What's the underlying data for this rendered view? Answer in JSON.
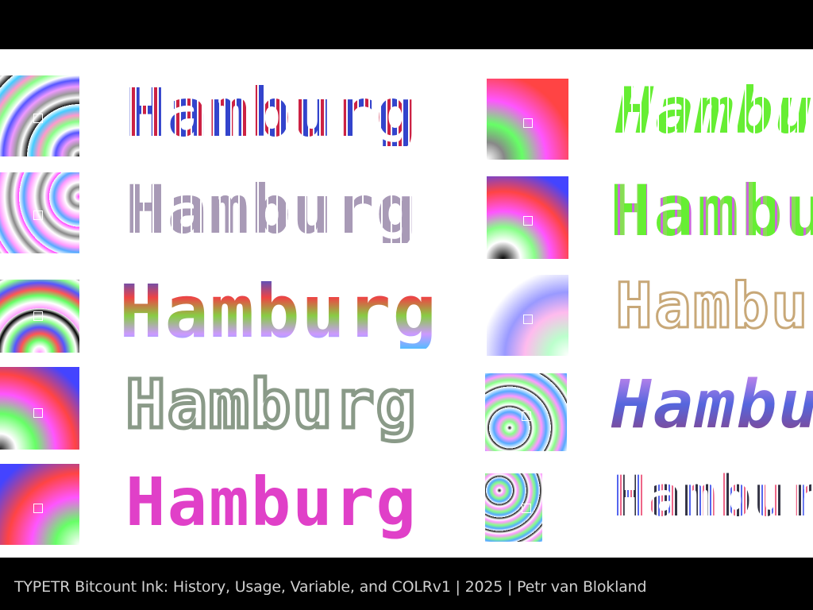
{
  "footer": {
    "text": "TYPETR Bitcount Ink: History, Usage, Variable, and COLRv1 | 2025 | Petr van Blokland"
  },
  "left_column": {
    "samples": [
      {
        "word": "Hamburg",
        "style": "red-blue-dots"
      },
      {
        "word": "Hamburg",
        "style": "grey-lilac-tiles"
      },
      {
        "word": "Hamburg",
        "style": "multicolor-tiles"
      },
      {
        "word": "Hamburg",
        "style": "green-purple-outline"
      },
      {
        "word": "Hamburg",
        "style": "magenta-dots"
      }
    ]
  },
  "right_column": {
    "samples": [
      {
        "word": "Hamburg",
        "style": "green-tiles"
      },
      {
        "word": "Hamburg",
        "style": "green-magenta-tiles"
      },
      {
        "word": "Hamburg",
        "style": "tan-outline"
      },
      {
        "word": "Hamburg",
        "style": "purple-blue-tiles"
      },
      {
        "word": "Hamburg",
        "style": "small-multicolor-glyphs"
      }
    ]
  }
}
